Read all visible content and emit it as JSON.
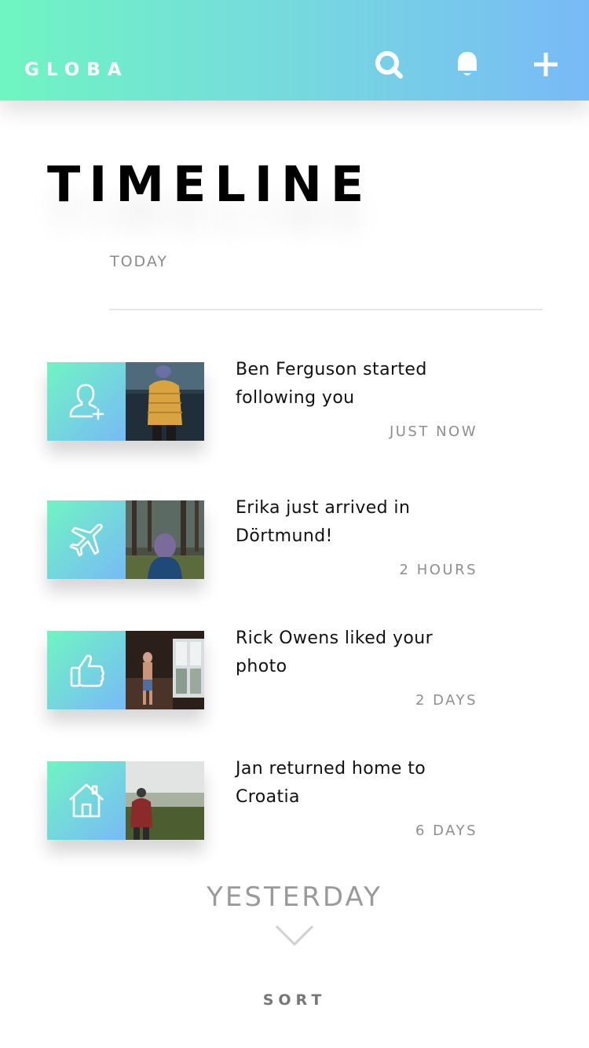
{
  "header": {
    "brand": "GLOBA",
    "icons": [
      "search-icon",
      "bell-icon",
      "plus-icon"
    ]
  },
  "page": {
    "title": "TIMELINE",
    "section_today": "TODAY"
  },
  "timeline": [
    {
      "icon": "add-user-icon",
      "line1": "Ben Ferguson started",
      "line2": "following you",
      "time": "JUST NOW"
    },
    {
      "icon": "airplane-icon",
      "line1": "Erika just arrived in",
      "line2": "Dörtmund!",
      "time": "2 HOURS"
    },
    {
      "icon": "thumbs-up-icon",
      "line1": "Rick Owens liked your",
      "line2": "photo",
      "time": "2 DAYS"
    },
    {
      "icon": "home-icon",
      "line1": "Jan returned home to",
      "line2": "Croatia",
      "time": "6 DAYS"
    }
  ],
  "footer": {
    "yesterday": "YESTERDAY",
    "sort": "SORT"
  },
  "colors": {
    "gradient_start": "#6ff5c2",
    "gradient_end": "#78baf7"
  }
}
